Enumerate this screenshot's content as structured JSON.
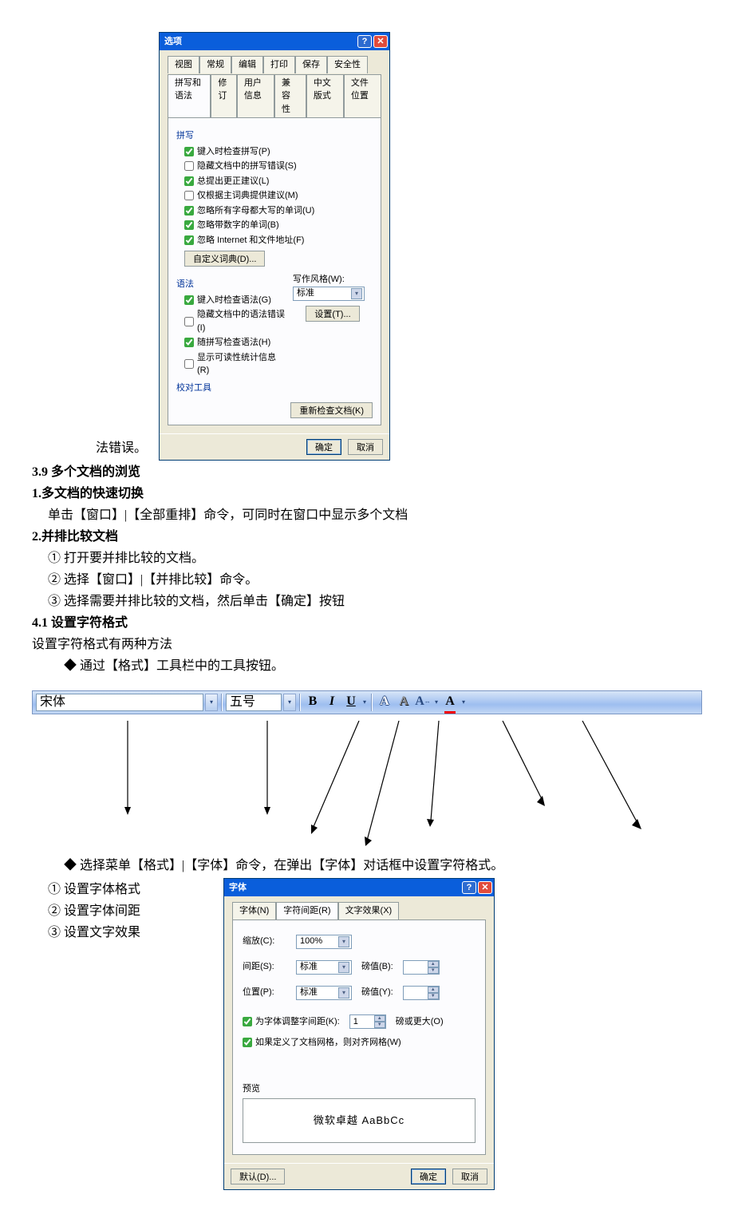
{
  "doc": {
    "fa_error": "法错误。",
    "sec39": "3.9  多个文档的浏览",
    "sec1": "1.多文档的快速切换",
    "sec1_line": "单击【窗口】|【全部重排】命令，可同时在窗口中显示多个文档",
    "sec2": "2.并排比较文档",
    "step1": "① 打开要并排比较的文档。",
    "step2": "② 选择【窗口】|【并排比较】命令。",
    "step3": "③ 选择需要并排比较的文档，然后单击【确定】按钮",
    "sec41": "4.1  设置字符格式",
    "sec41_line": "设置字符格式有两种方法",
    "bullet1": "◆   通过【格式】工具栏中的工具按钮。",
    "bullet2": "◆  选择菜单【格式】|【字体】命令，在弹出【字体】对话框中设置字符格式。",
    "b_step1": "① 设置字体格式",
    "b_step2": "② 设置字体间距",
    "b_step3": "③ 设置文字效果"
  },
  "options_dialog": {
    "title": "选项",
    "tabs_row1": [
      "视图",
      "常规",
      "编辑",
      "打印",
      "保存",
      "安全性"
    ],
    "tabs_row2": [
      "拼写和语法",
      "修订",
      "用户信息",
      "兼容性",
      "中文版式",
      "文件位置"
    ],
    "group_spell": "拼写",
    "spell_checks": [
      {
        "label": "键入时检查拼写(P)",
        "checked": true
      },
      {
        "label": "隐藏文档中的拼写错误(S)",
        "checked": false
      },
      {
        "label": "总提出更正建议(L)",
        "checked": true
      },
      {
        "label": "仅根据主词典提供建议(M)",
        "checked": false
      },
      {
        "label": "忽略所有字母都大写的单词(U)",
        "checked": true
      },
      {
        "label": "忽略带数字的单词(B)",
        "checked": true
      },
      {
        "label": "忽略 Internet 和文件地址(F)",
        "checked": true
      }
    ],
    "custom_dict_btn": "自定义词典(D)...",
    "group_grammar": "语法",
    "grammar_checks": [
      {
        "label": "键入时检查语法(G)",
        "checked": true
      },
      {
        "label": "隐藏文档中的语法错误(I)",
        "checked": false
      },
      {
        "label": "随拼写检查语法(H)",
        "checked": true
      },
      {
        "label": "显示可读性统计信息(R)",
        "checked": false
      }
    ],
    "style_label": "写作风格(W):",
    "style_value": "标准",
    "settings_btn": "设置(T)...",
    "proof_link": "校对工具",
    "recheck_btn": "重新检查文档(K)",
    "ok": "确定",
    "cancel": "取消"
  },
  "toolbar": {
    "font_name": "宋体",
    "font_size": "五号"
  },
  "font_dialog": {
    "title": "字体",
    "tabs": [
      "字体(N)",
      "字符间距(R)",
      "文字效果(X)"
    ],
    "scale_label": "缩放(C):",
    "scale_value": "100%",
    "spacing_label": "间距(S):",
    "spacing_value": "标准",
    "spacing_amt_label": "磅值(B):",
    "spacing_amt": "",
    "position_label": "位置(P):",
    "position_value": "标准",
    "position_amt_label": "磅值(Y):",
    "position_amt": "",
    "kern_check": "为字体调整字间距(K):",
    "kern_value": "1",
    "kern_suffix": "磅或更大(O)",
    "grid_check": "如果定义了文档网格，则对齐网格(W)",
    "preview_label": "预览",
    "preview_text": "微软卓越 AaBbCc",
    "default_btn": "默认(D)...",
    "ok": "确定",
    "cancel": "取消"
  }
}
